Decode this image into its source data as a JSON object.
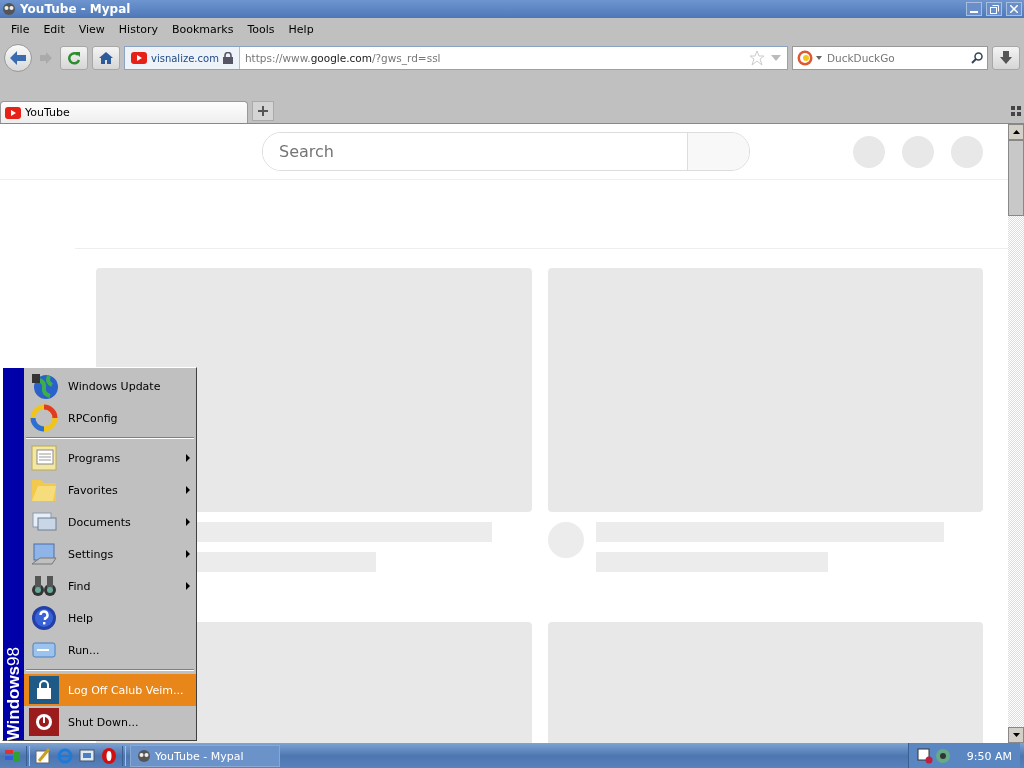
{
  "window": {
    "title": "YouTube - Mypal"
  },
  "menu_bar": [
    "File",
    "Edit",
    "View",
    "History",
    "Bookmarks",
    "Tools",
    "Help"
  ],
  "nav": {
    "site_identity": "visnalize.com",
    "url": {
      "prefix": "https://www.",
      "domain": "google.com",
      "suffix": "/?gws_rd=ssl"
    },
    "search_placeholder": "DuckDuckGo"
  },
  "tabs": [
    {
      "label": "YouTube",
      "selected": true
    }
  ],
  "page": {
    "search_placeholder": "Search"
  },
  "start_menu": {
    "banner": "**Windows**98",
    "sections": [
      [
        {
          "label": "Windows Update",
          "submenu": false,
          "selected": false
        },
        {
          "label": "RPConfig",
          "submenu": false,
          "selected": false
        }
      ],
      [
        {
          "label": "Programs",
          "submenu": true,
          "selected": false
        },
        {
          "label": "Favorites",
          "submenu": true,
          "selected": false
        },
        {
          "label": "Documents",
          "submenu": true,
          "selected": false
        },
        {
          "label": "Settings",
          "submenu": true,
          "selected": false
        },
        {
          "label": "Find",
          "submenu": true,
          "selected": false
        },
        {
          "label": "Help",
          "submenu": false,
          "selected": false
        },
        {
          "label": "Run...",
          "submenu": false,
          "selected": false
        }
      ],
      [
        {
          "label": "Log Off Calub Veim...",
          "submenu": false,
          "selected": true
        },
        {
          "label": "Shut Down...",
          "submenu": false,
          "selected": false
        }
      ]
    ]
  },
  "taskbar": {
    "tasks": [
      {
        "label": "YouTube - Mypal",
        "selected": false
      }
    ],
    "clock": "9:50 AM"
  }
}
